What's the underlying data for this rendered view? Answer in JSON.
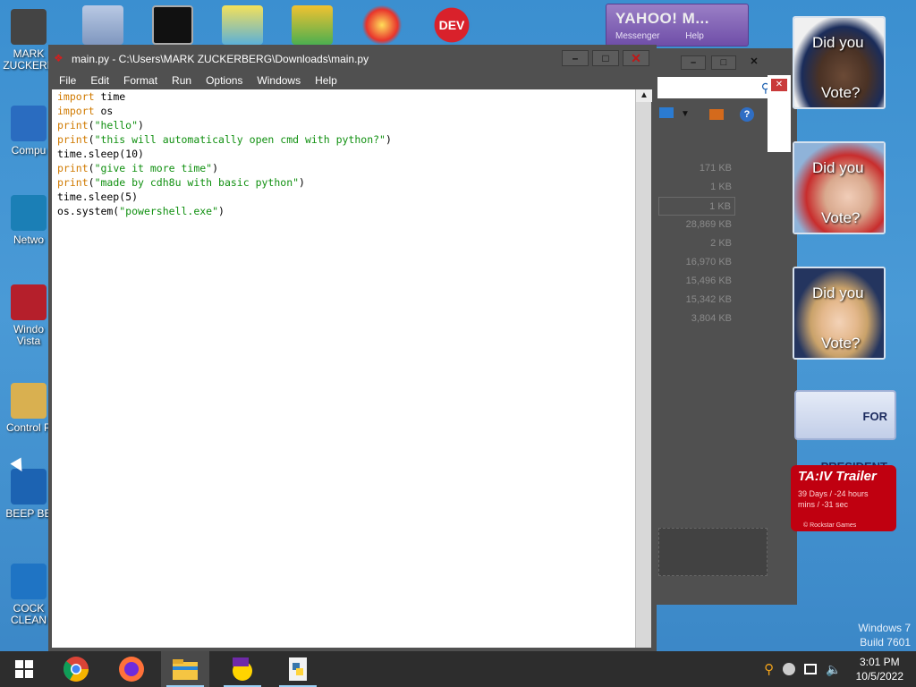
{
  "desktop": {
    "icons": [
      {
        "name": "MARK\nZUCKERB",
        "icon": "user-folder-icon"
      },
      {
        "name": "Compu",
        "icon": "computer-icon"
      },
      {
        "name": "Netwo",
        "icon": "network-icon"
      },
      {
        "name": "Windo\nVista",
        "icon": "recycle-bin-icon"
      },
      {
        "name": "Control P",
        "icon": "control-panel-icon"
      },
      {
        "name": "BEEP BE",
        "icon": "app-icon"
      },
      {
        "name": "COCK\nCLEAN",
        "icon": "app-icon"
      }
    ]
  },
  "yahoo": {
    "title": "YAHOO! M...",
    "menu": [
      "Messenger",
      "Help"
    ]
  },
  "explorer_bg": {
    "sizes": [
      "171 KB",
      "1 KB",
      "1 KB",
      "28,869 KB",
      "2 KB",
      "16,970 KB",
      "15,496 KB",
      "15,342 KB",
      "3,804 KB"
    ]
  },
  "gadgets": {
    "vote_text_1": "Did you",
    "vote_text_2": "Vote?",
    "president": "FOR PRESIDENT",
    "gta_title": "TA:IV Trailer",
    "gta_line1": "39 Days / -24 hours",
    "gta_line2": "mins / -31 sec",
    "gta_brand": "© Rockstar Games"
  },
  "idle": {
    "title": "main.py - C:\\Users\\MARK ZUCKERBERG\\Downloads\\main.py",
    "menu": [
      "File",
      "Edit",
      "Format",
      "Run",
      "Options",
      "Windows",
      "Help"
    ],
    "code": [
      [
        {
          "t": "kw",
          "v": "import"
        },
        {
          "t": "n",
          "v": " time"
        }
      ],
      [
        {
          "t": "kw",
          "v": "import"
        },
        {
          "t": "n",
          "v": " os"
        }
      ],
      [
        {
          "t": "kw",
          "v": "print"
        },
        {
          "t": "n",
          "v": "("
        },
        {
          "t": "str",
          "v": "\"hello\""
        },
        {
          "t": "n",
          "v": ")"
        }
      ],
      [
        {
          "t": "kw",
          "v": "print"
        },
        {
          "t": "n",
          "v": "("
        },
        {
          "t": "str",
          "v": "\"this will automatically open cmd with python?\""
        },
        {
          "t": "n",
          "v": ")"
        }
      ],
      [
        {
          "t": "n",
          "v": "time.sleep(10)"
        }
      ],
      [
        {
          "t": "kw",
          "v": "print"
        },
        {
          "t": "n",
          "v": "("
        },
        {
          "t": "str",
          "v": "\"give it more time\""
        },
        {
          "t": "n",
          "v": ")"
        }
      ],
      [
        {
          "t": "kw",
          "v": "print"
        },
        {
          "t": "n",
          "v": "("
        },
        {
          "t": "str",
          "v": "\"made by cdh8u with basic python\""
        },
        {
          "t": "n",
          "v": ")"
        }
      ],
      [
        {
          "t": "n",
          "v": "time.sleep(5)"
        }
      ],
      [
        {
          "t": "n",
          "v": "os.system("
        },
        {
          "t": "str",
          "v": "\"powershell.exe\""
        },
        {
          "t": "n",
          "v": ")"
        }
      ]
    ]
  },
  "watermark": {
    "line1": "Windows 7",
    "line2": "Build 7601"
  },
  "taskbar": {
    "clock_time": "3:01 PM",
    "clock_date": "10/5/2022"
  }
}
